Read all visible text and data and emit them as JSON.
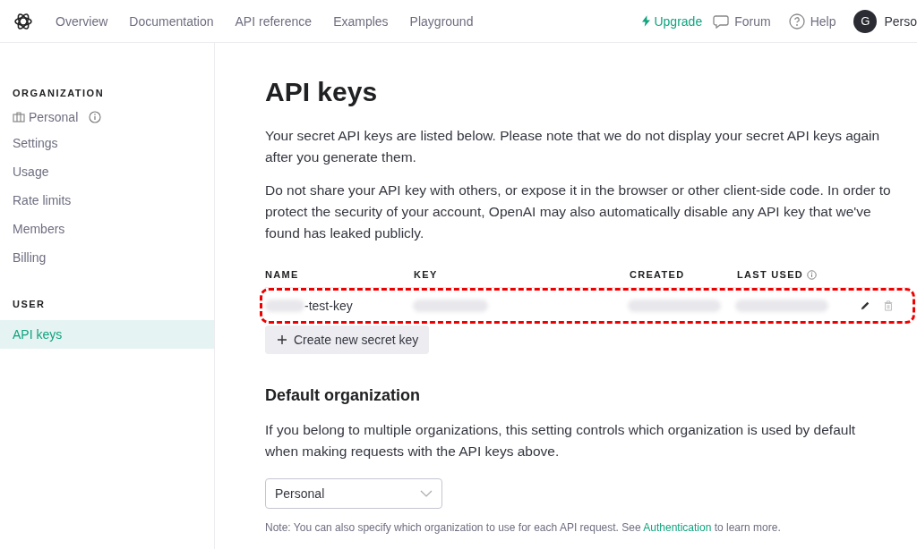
{
  "nav": {
    "links": [
      {
        "label": "Overview",
        "selected": false
      },
      {
        "label": "Documentation",
        "selected": false
      },
      {
        "label": "API reference",
        "selected": false
      },
      {
        "label": "Examples",
        "selected": false
      },
      {
        "label": "Playground",
        "selected": false
      }
    ],
    "upgrade": "Upgrade",
    "forum": "Forum",
    "help": "Help",
    "avatar": "G",
    "user": "Perso"
  },
  "sidebar": {
    "sections": [
      {
        "heading": "ORGANIZATION",
        "items": [
          {
            "label": "Personal",
            "kind": "org",
            "selected": false
          },
          {
            "label": "Settings",
            "kind": "link",
            "selected": false
          },
          {
            "label": "Usage",
            "kind": "link",
            "selected": false
          },
          {
            "label": "Rate limits",
            "kind": "link",
            "selected": false
          },
          {
            "label": "Members",
            "kind": "link",
            "selected": false
          },
          {
            "label": "Billing",
            "kind": "link",
            "selected": false
          }
        ]
      },
      {
        "heading": "USER",
        "items": [
          {
            "label": "API keys",
            "kind": "link",
            "selected": true
          }
        ]
      }
    ]
  },
  "title": "API keys",
  "paragraphs": [
    "Your secret API keys are listed below. Please note that we do not display your secret API keys again after you generate them.",
    "Do not share your API key with others, or expose it in the browser or other client-side code. In order to protect the security of your account, OpenAI may also automatically disable any API key that we've found has leaked publicly."
  ],
  "table": {
    "columns": [
      "NAME",
      "KEY",
      "CREATED",
      "LAST USED"
    ],
    "rows": [
      {
        "name": "-test-key"
      }
    ]
  },
  "create_button": "Create new secret key",
  "default_org": {
    "heading": "Default organization",
    "text": "If you belong to multiple organizations, this setting controls which organization is used by default when making requests with the API keys above.",
    "select": "Personal",
    "note_before": "Note: You can also specify which organization to use for each API request. See ",
    "note_link": "Authentication",
    "note_after": " to learn more."
  }
}
